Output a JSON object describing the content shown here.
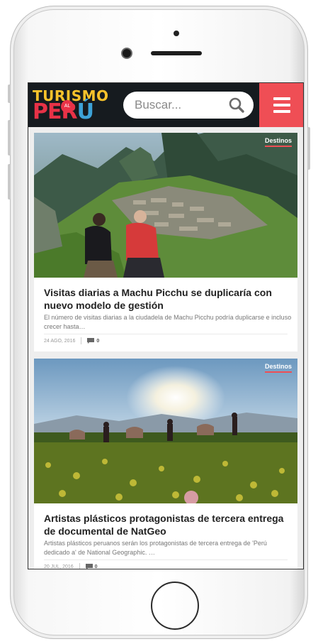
{
  "header": {
    "logo_line1": "TURISMO",
    "logo_badge": "AL",
    "logo_line2a": "PER",
    "logo_line2b": "Ú",
    "search_placeholder": "Buscar..."
  },
  "colors": {
    "topbar": "#161b1f",
    "accent": "#ef4e55",
    "logo_yellow": "#f7c22b",
    "logo_blue": "#3da3d8"
  },
  "articles": [
    {
      "tag": "Destinos",
      "title": "Visitas diarias a Machu Picchu se duplicaría con nuevo modelo de gestión",
      "excerpt": "El número de visitas diarias a la ciudadela de Machu Picchu podría duplicarse e incluso crecer hasta…",
      "date": "24 AGO, 2016",
      "comments": "0"
    },
    {
      "tag": "Destinos",
      "title": "Artistas plásticos protagonistas de tercera entrega de documental de NatGeo",
      "excerpt": "Artistas plásticos peruanos serán los protagonistas de tercera entrega de 'Perú dedicado a' de National Geographic. …",
      "date": "20 JUL, 2016",
      "comments": "0"
    }
  ]
}
